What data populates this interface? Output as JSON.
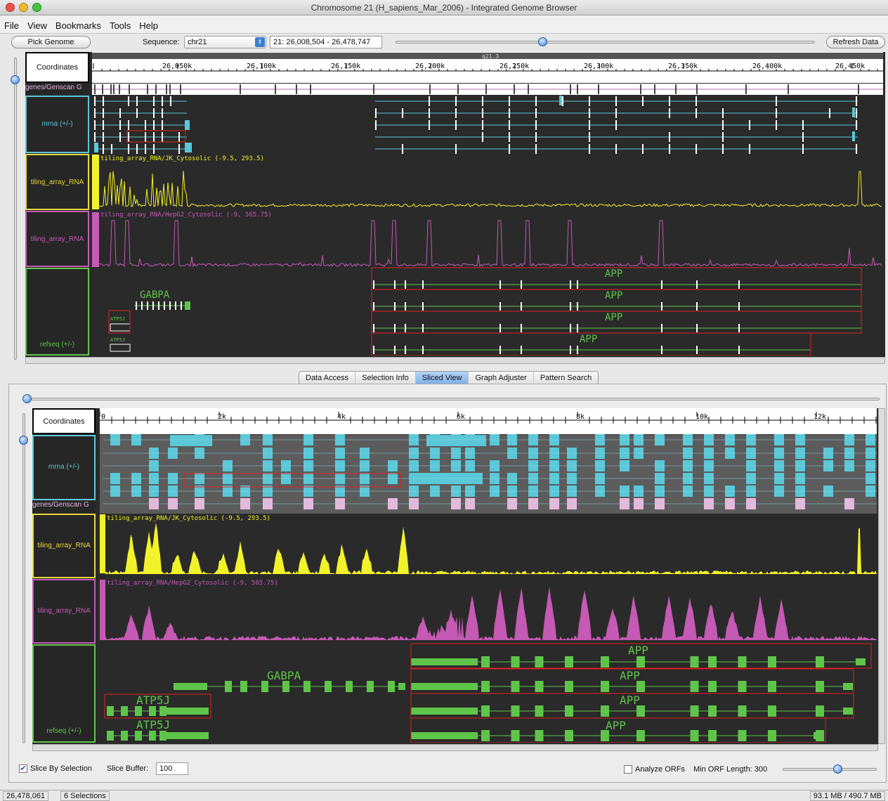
{
  "window": {
    "title": "Chromosome 21  (H_sapiens_Mar_2006) - Integrated Genome Browser"
  },
  "menu": [
    "File",
    "View",
    "Bookmarks",
    "Tools",
    "Help"
  ],
  "toolbar": {
    "pick_genome": "Pick Genome",
    "sequence_label": "Sequence:",
    "sequence_value": "chr21",
    "range": "21: 26,008,504 - 26,478,747",
    "refresh": "Refresh Data"
  },
  "top": {
    "coordinates_label": "Coordinates",
    "band": "q21.3",
    "ticks": [
      "26,050k",
      "26,100k",
      "26,150k",
      "26,200k",
      "26,250k",
      "26,300k",
      "26,350k",
      "26,400k",
      "26,450k"
    ],
    "tracks": {
      "genscan": "genes/Genscan G",
      "mrna": "mrna (+/-)",
      "tiling1": "tiling_array_RNA",
      "tiling2": "tiling_array_RNA",
      "refseq": "refseq (+/-)"
    },
    "graph1_label": "tiling_array_RNA/JK_Cytosolic (-9.5, 293.5)",
    "graph2_label": "tiling_array_RNA/HepG2_Cytosolic (-9, 565.75)",
    "genes": {
      "gabpa": "GABPA",
      "app": "APP",
      "atp5j": "ATP5J"
    }
  },
  "tabs": [
    "Data Access",
    "Selection Info",
    "Sliced View",
    "Graph Adjuster",
    "Pattern Search"
  ],
  "sliced": {
    "coordinates_label": "Coordinates",
    "ticks": [
      "0",
      "2k",
      "4k",
      "6k",
      "8k",
      "10k",
      "12k"
    ],
    "tracks": {
      "mrna": "mrna (+/-)",
      "genscan": "genes/Genscan G",
      "tiling1": "tiling_array_RNA",
      "tiling2": "tiling_array_RNA",
      "refseq": "refseq (+/-)"
    },
    "graph1_label": "tiling_array_RNA/JK_Cytosolic (-9.5, 293.5)",
    "graph2_label": "tiling_array_RNA/HepG2_Cytosolic (-9, 565.75)",
    "genes": {
      "gabpa": "GABPA",
      "app": "APP",
      "atp5j": "ATP5J"
    }
  },
  "options": {
    "slice_by_selection": "Slice By Selection",
    "slice_buffer_label": "Slice Buffer:",
    "slice_buffer_value": "100",
    "analyze_orfs": "Analyze ORFs",
    "min_orf": "Min ORF Length: 300"
  },
  "status": {
    "position": "26,478,061",
    "selections": "6 Selections",
    "memory": "93.1 MB / 490.7 MB"
  },
  "colors": {
    "mrna": "#5bc8d8",
    "graph1": "#f2f22a",
    "graph2": "#c45ab4",
    "refseq": "#5fc54a",
    "selection": "#e02020"
  }
}
